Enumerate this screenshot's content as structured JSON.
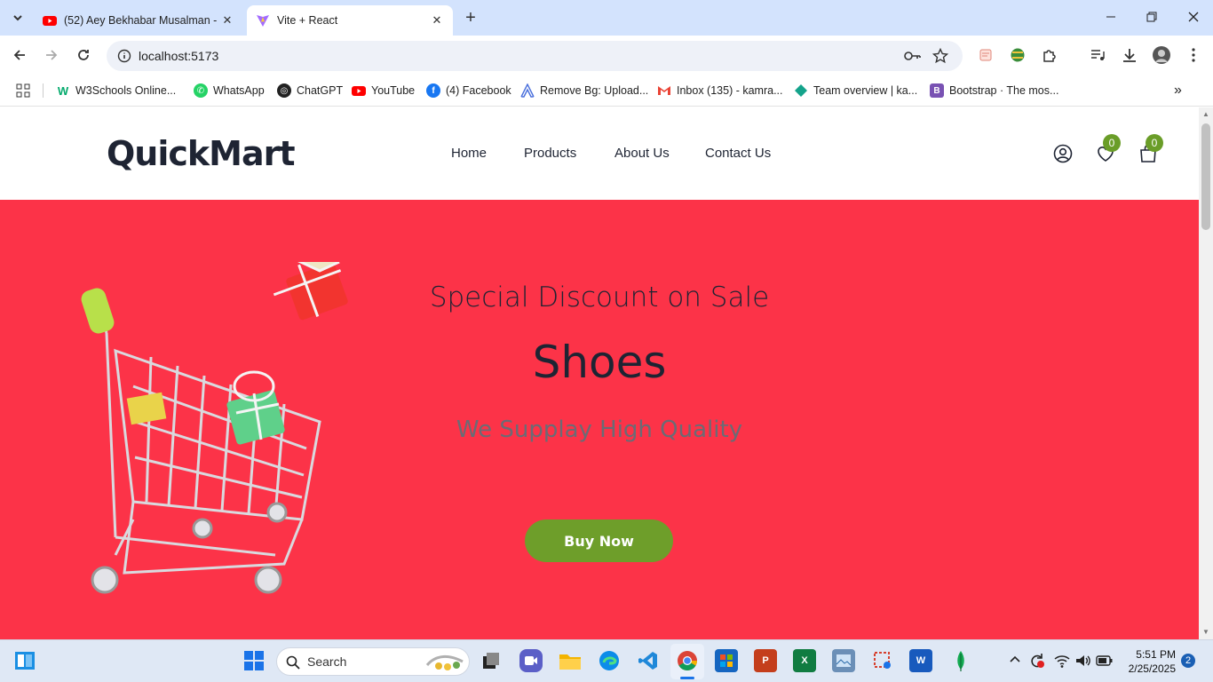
{
  "browser": {
    "tabs": [
      {
        "title": "(52) Aey Bekhabar Musalman -",
        "favicon": "youtube-icon"
      },
      {
        "title": "Vite + React",
        "favicon": "vite-icon"
      }
    ],
    "address": "localhost:5173",
    "bookmarks": [
      {
        "label": "W3Schools Online...",
        "icon": "w3schools-icon"
      },
      {
        "label": "WhatsApp",
        "icon": "whatsapp-icon"
      },
      {
        "label": "ChatGPT",
        "icon": "chatgpt-icon"
      },
      {
        "label": "YouTube",
        "icon": "youtube-icon"
      },
      {
        "label": "(4) Facebook",
        "icon": "facebook-icon"
      },
      {
        "label": "Remove Bg: Upload...",
        "icon": "removebg-icon"
      },
      {
        "label": "Inbox (135) - kamra...",
        "icon": "gmail-icon"
      },
      {
        "label": "Team overview | ka...",
        "icon": "team-icon"
      },
      {
        "label": "Bootstrap · The mos...",
        "icon": "bootstrap-icon"
      }
    ]
  },
  "site": {
    "brand": "QuickMart",
    "nav": [
      "Home",
      "Products",
      "About Us",
      "Contact Us"
    ],
    "wishlist_count": "0",
    "cart_count": "0"
  },
  "hero": {
    "subtitle": "Special Discount on Sale",
    "title": "Shoes",
    "tagline": "We Supplay High Quality",
    "cta": "Buy Now"
  },
  "taskbar": {
    "search_placeholder": "Search",
    "time": "5:51 PM",
    "date": "2/25/2025",
    "notification_count": "2"
  },
  "colors": {
    "hero_bg": "#fc3348",
    "accent_green": "#6e9e2a",
    "text_dark": "#1e2433"
  }
}
